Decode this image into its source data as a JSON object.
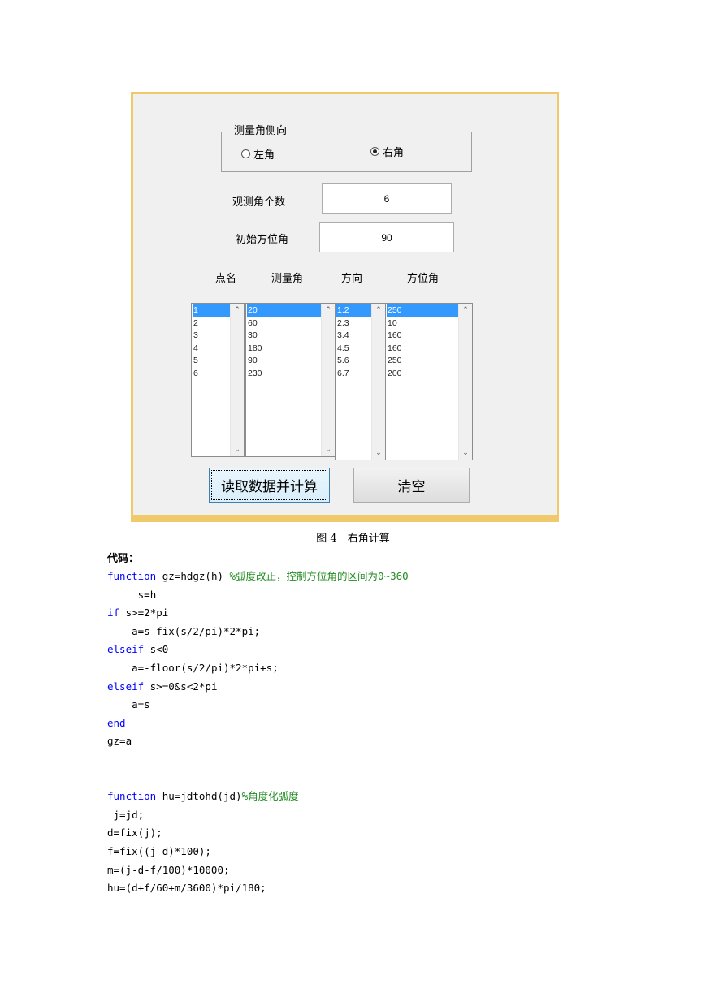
{
  "gui": {
    "group_title": "测量角侧向",
    "radio_left_label": "左角",
    "radio_right_label": "右角",
    "selected_radio": "右角",
    "count_label": "观测角个数",
    "count_value": "6",
    "azimuth_label": "初始方位角",
    "azimuth_value": "90",
    "columns": [
      "点名",
      "测量角",
      "方向",
      "方位角"
    ],
    "point_names": [
      "1",
      "2",
      "3",
      "4",
      "5",
      "6"
    ],
    "measured_angles": [
      "20",
      "60",
      "30",
      "180",
      "90",
      "230"
    ],
    "directions": [
      "1.2",
      "2.3",
      "3.4",
      "4.5",
      "5.6",
      "6.7"
    ],
    "azimuths": [
      "250",
      "10",
      "160",
      "160",
      "250",
      "200"
    ],
    "compute_button": "读取数据并计算",
    "clear_button": "清空"
  },
  "document": {
    "caption": "图 4　右角计算",
    "code_label": "代码：",
    "code_lines": [
      {
        "indent": "",
        "kw": "function",
        "text": " gz=hdgz(h) ",
        "comment": "%弧度改正，控制方位角的区间为0~360"
      },
      {
        "indent": "     ",
        "kw": "",
        "text": "s=h",
        "comment": ""
      },
      {
        "indent": "",
        "kw": "if",
        "text": " s>=2*pi",
        "comment": ""
      },
      {
        "indent": "    ",
        "kw": "",
        "text": "a=s-fix(s/2/pi)*2*pi;",
        "comment": ""
      },
      {
        "indent": "",
        "kw": "elseif",
        "text": " s<0",
        "comment": ""
      },
      {
        "indent": "    ",
        "kw": "",
        "text": "a=-floor(s/2/pi)*2*pi+s;",
        "comment": ""
      },
      {
        "indent": "",
        "kw": "elseif",
        "text": " s>=0&s<2*pi",
        "comment": ""
      },
      {
        "indent": "    ",
        "kw": "",
        "text": "a=s",
        "comment": ""
      },
      {
        "indent": "",
        "kw": "end",
        "text": "",
        "comment": ""
      },
      {
        "indent": "",
        "kw": "",
        "text": "gz=a",
        "comment": ""
      },
      {
        "indent": "",
        "kw": "",
        "text": "",
        "comment": ""
      },
      {
        "indent": "",
        "kw": "",
        "text": "",
        "comment": ""
      },
      {
        "indent": "",
        "kw": "function",
        "text": " hu=jdtohd(jd)",
        "comment": "%角度化弧度"
      },
      {
        "indent": " ",
        "kw": "",
        "text": "j=jd;",
        "comment": ""
      },
      {
        "indent": "",
        "kw": "",
        "text": "d=fix(j);",
        "comment": ""
      },
      {
        "indent": "",
        "kw": "",
        "text": "f=fix((j-d)*100);",
        "comment": ""
      },
      {
        "indent": "",
        "kw": "",
        "text": "m=(j-d-f/100)*10000;",
        "comment": ""
      },
      {
        "indent": "",
        "kw": "",
        "text": "hu=(d+f/60+m/3600)*pi/180;",
        "comment": ""
      }
    ]
  }
}
